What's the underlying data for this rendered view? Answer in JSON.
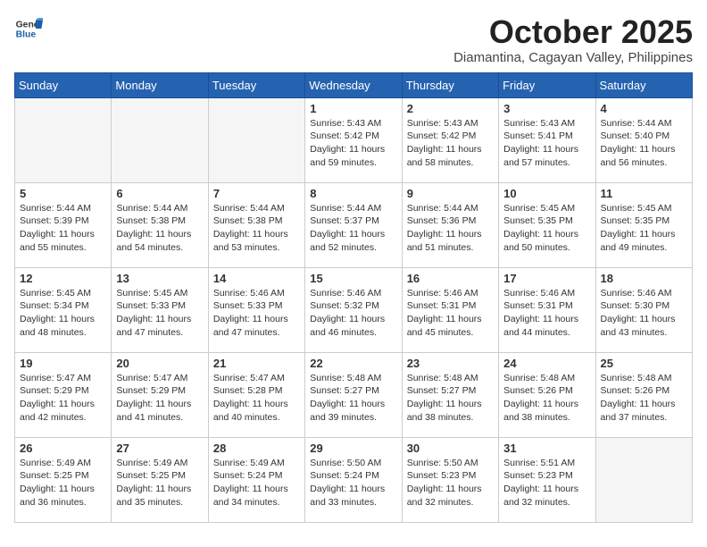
{
  "header": {
    "logo_general": "General",
    "logo_blue": "Blue",
    "month_title": "October 2025",
    "subtitle": "Diamantina, Cagayan Valley, Philippines"
  },
  "days_of_week": [
    "Sunday",
    "Monday",
    "Tuesday",
    "Wednesday",
    "Thursday",
    "Friday",
    "Saturday"
  ],
  "weeks": [
    [
      {
        "day": "",
        "sunrise": "",
        "sunset": "",
        "daylight": "",
        "empty": true
      },
      {
        "day": "",
        "sunrise": "",
        "sunset": "",
        "daylight": "",
        "empty": true
      },
      {
        "day": "",
        "sunrise": "",
        "sunset": "",
        "daylight": "",
        "empty": true
      },
      {
        "day": "1",
        "sunrise": "Sunrise: 5:43 AM",
        "sunset": "Sunset: 5:42 PM",
        "daylight": "Daylight: 11 hours and 59 minutes."
      },
      {
        "day": "2",
        "sunrise": "Sunrise: 5:43 AM",
        "sunset": "Sunset: 5:42 PM",
        "daylight": "Daylight: 11 hours and 58 minutes."
      },
      {
        "day": "3",
        "sunrise": "Sunrise: 5:43 AM",
        "sunset": "Sunset: 5:41 PM",
        "daylight": "Daylight: 11 hours and 57 minutes."
      },
      {
        "day": "4",
        "sunrise": "Sunrise: 5:44 AM",
        "sunset": "Sunset: 5:40 PM",
        "daylight": "Daylight: 11 hours and 56 minutes."
      }
    ],
    [
      {
        "day": "5",
        "sunrise": "Sunrise: 5:44 AM",
        "sunset": "Sunset: 5:39 PM",
        "daylight": "Daylight: 11 hours and 55 minutes."
      },
      {
        "day": "6",
        "sunrise": "Sunrise: 5:44 AM",
        "sunset": "Sunset: 5:38 PM",
        "daylight": "Daylight: 11 hours and 54 minutes."
      },
      {
        "day": "7",
        "sunrise": "Sunrise: 5:44 AM",
        "sunset": "Sunset: 5:38 PM",
        "daylight": "Daylight: 11 hours and 53 minutes."
      },
      {
        "day": "8",
        "sunrise": "Sunrise: 5:44 AM",
        "sunset": "Sunset: 5:37 PM",
        "daylight": "Daylight: 11 hours and 52 minutes."
      },
      {
        "day": "9",
        "sunrise": "Sunrise: 5:44 AM",
        "sunset": "Sunset: 5:36 PM",
        "daylight": "Daylight: 11 hours and 51 minutes."
      },
      {
        "day": "10",
        "sunrise": "Sunrise: 5:45 AM",
        "sunset": "Sunset: 5:35 PM",
        "daylight": "Daylight: 11 hours and 50 minutes."
      },
      {
        "day": "11",
        "sunrise": "Sunrise: 5:45 AM",
        "sunset": "Sunset: 5:35 PM",
        "daylight": "Daylight: 11 hours and 49 minutes."
      }
    ],
    [
      {
        "day": "12",
        "sunrise": "Sunrise: 5:45 AM",
        "sunset": "Sunset: 5:34 PM",
        "daylight": "Daylight: 11 hours and 48 minutes."
      },
      {
        "day": "13",
        "sunrise": "Sunrise: 5:45 AM",
        "sunset": "Sunset: 5:33 PM",
        "daylight": "Daylight: 11 hours and 47 minutes."
      },
      {
        "day": "14",
        "sunrise": "Sunrise: 5:46 AM",
        "sunset": "Sunset: 5:33 PM",
        "daylight": "Daylight: 11 hours and 47 minutes."
      },
      {
        "day": "15",
        "sunrise": "Sunrise: 5:46 AM",
        "sunset": "Sunset: 5:32 PM",
        "daylight": "Daylight: 11 hours and 46 minutes."
      },
      {
        "day": "16",
        "sunrise": "Sunrise: 5:46 AM",
        "sunset": "Sunset: 5:31 PM",
        "daylight": "Daylight: 11 hours and 45 minutes."
      },
      {
        "day": "17",
        "sunrise": "Sunrise: 5:46 AM",
        "sunset": "Sunset: 5:31 PM",
        "daylight": "Daylight: 11 hours and 44 minutes."
      },
      {
        "day": "18",
        "sunrise": "Sunrise: 5:46 AM",
        "sunset": "Sunset: 5:30 PM",
        "daylight": "Daylight: 11 hours and 43 minutes."
      }
    ],
    [
      {
        "day": "19",
        "sunrise": "Sunrise: 5:47 AM",
        "sunset": "Sunset: 5:29 PM",
        "daylight": "Daylight: 11 hours and 42 minutes."
      },
      {
        "day": "20",
        "sunrise": "Sunrise: 5:47 AM",
        "sunset": "Sunset: 5:29 PM",
        "daylight": "Daylight: 11 hours and 41 minutes."
      },
      {
        "day": "21",
        "sunrise": "Sunrise: 5:47 AM",
        "sunset": "Sunset: 5:28 PM",
        "daylight": "Daylight: 11 hours and 40 minutes."
      },
      {
        "day": "22",
        "sunrise": "Sunrise: 5:48 AM",
        "sunset": "Sunset: 5:27 PM",
        "daylight": "Daylight: 11 hours and 39 minutes."
      },
      {
        "day": "23",
        "sunrise": "Sunrise: 5:48 AM",
        "sunset": "Sunset: 5:27 PM",
        "daylight": "Daylight: 11 hours and 38 minutes."
      },
      {
        "day": "24",
        "sunrise": "Sunrise: 5:48 AM",
        "sunset": "Sunset: 5:26 PM",
        "daylight": "Daylight: 11 hours and 38 minutes."
      },
      {
        "day": "25",
        "sunrise": "Sunrise: 5:48 AM",
        "sunset": "Sunset: 5:26 PM",
        "daylight": "Daylight: 11 hours and 37 minutes."
      }
    ],
    [
      {
        "day": "26",
        "sunrise": "Sunrise: 5:49 AM",
        "sunset": "Sunset: 5:25 PM",
        "daylight": "Daylight: 11 hours and 36 minutes."
      },
      {
        "day": "27",
        "sunrise": "Sunrise: 5:49 AM",
        "sunset": "Sunset: 5:25 PM",
        "daylight": "Daylight: 11 hours and 35 minutes."
      },
      {
        "day": "28",
        "sunrise": "Sunrise: 5:49 AM",
        "sunset": "Sunset: 5:24 PM",
        "daylight": "Daylight: 11 hours and 34 minutes."
      },
      {
        "day": "29",
        "sunrise": "Sunrise: 5:50 AM",
        "sunset": "Sunset: 5:24 PM",
        "daylight": "Daylight: 11 hours and 33 minutes."
      },
      {
        "day": "30",
        "sunrise": "Sunrise: 5:50 AM",
        "sunset": "Sunset: 5:23 PM",
        "daylight": "Daylight: 11 hours and 32 minutes."
      },
      {
        "day": "31",
        "sunrise": "Sunrise: 5:51 AM",
        "sunset": "Sunset: 5:23 PM",
        "daylight": "Daylight: 11 hours and 32 minutes."
      },
      {
        "day": "",
        "sunrise": "",
        "sunset": "",
        "daylight": "",
        "empty": true
      }
    ]
  ]
}
